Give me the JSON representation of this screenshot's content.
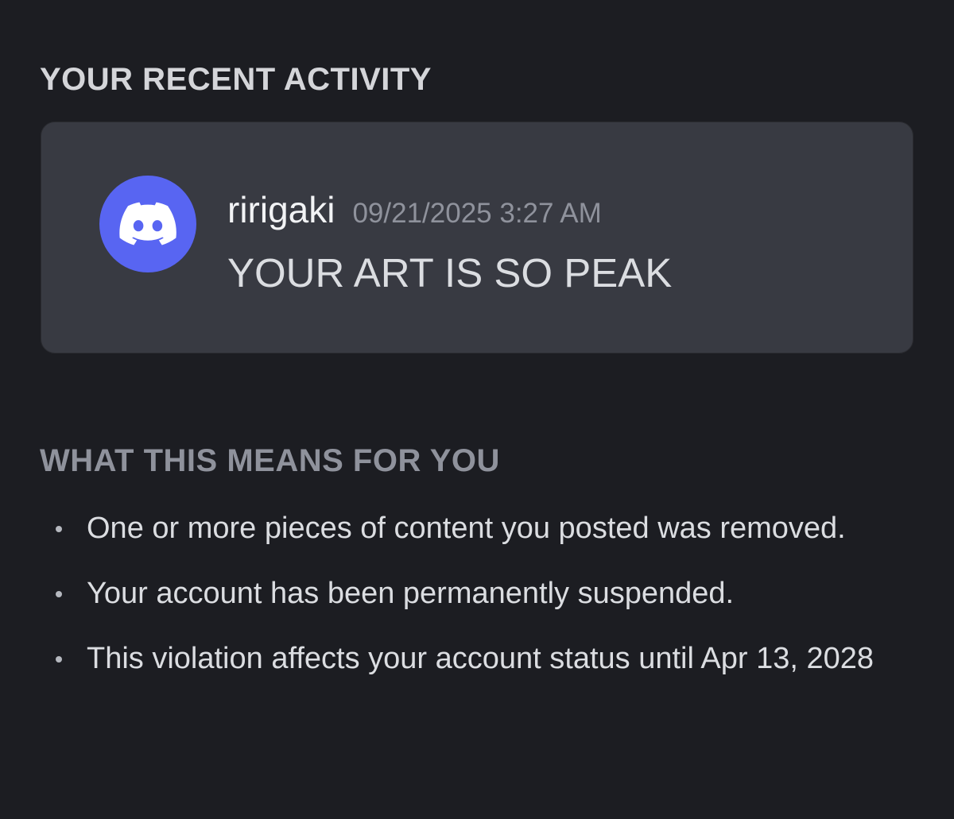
{
  "recent_activity": {
    "heading": "YOUR RECENT ACTIVITY",
    "message": {
      "avatar_icon": "discord-logo-icon",
      "avatar_color": "#5865f2",
      "username": "ririgaki",
      "timestamp": "09/21/2025 3:27 AM",
      "text": "YOUR ART IS SO PEAK"
    }
  },
  "consequences": {
    "heading": "WHAT THIS MEANS FOR YOU",
    "items": [
      {
        "text": "One or more pieces of content you posted was removed."
      },
      {
        "text": "Your account has been permanently suspended."
      },
      {
        "text": "This violation affects your account status until Apr 13, 2028"
      }
    ]
  },
  "colors": {
    "background": "#1c1d22",
    "card": "#383a42",
    "brand": "#5865f2"
  }
}
